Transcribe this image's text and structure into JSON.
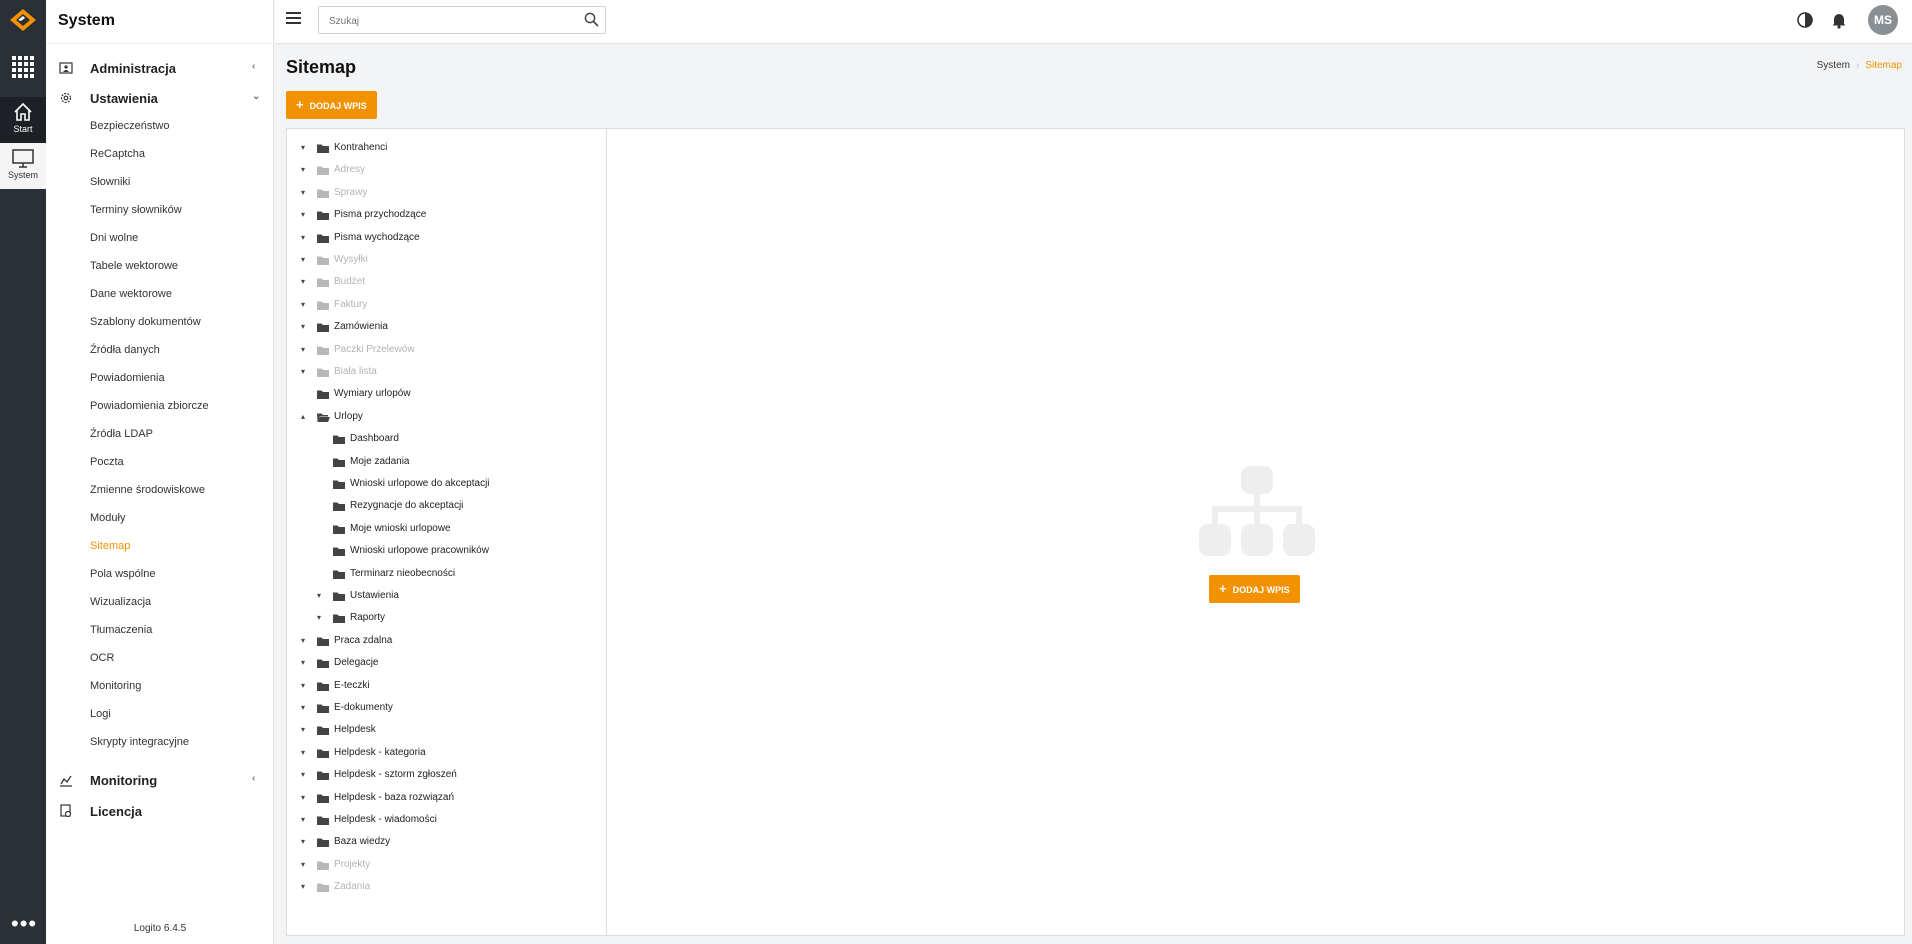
{
  "rail": {
    "items": [
      {
        "label": "Start"
      },
      {
        "label": "System"
      }
    ]
  },
  "sidebar": {
    "title": "System",
    "groups": [
      {
        "label": "Administracja",
        "expanded": false
      },
      {
        "label": "Ustawienia",
        "expanded": true
      },
      {
        "label": "Monitoring",
        "expanded": false
      },
      {
        "label": "Licencja"
      }
    ],
    "sub_items": [
      "Bezpieczeństwo",
      "ReCaptcha",
      "Słowniki",
      "Terminy słowników",
      "Dni wolne",
      "Tabele wektorowe",
      "Dane wektorowe",
      "Szablony dokumentów",
      "Źródła danych",
      "Powiadomienia",
      "Powiadomienia zbiorcze",
      "Źródła LDAP",
      "Poczta",
      "Zmienne środowiskowe",
      "Moduły",
      "Sitemap",
      "Pola wspólne",
      "Wizualizacja",
      "Tłumaczenia",
      "OCR",
      "Monitoring",
      "Logi",
      "Skrypty integracyjne"
    ],
    "active_sub": "Sitemap",
    "version": "Logito 6.4.5"
  },
  "topbar": {
    "search_placeholder": "Szukaj",
    "avatar_initials": "MS"
  },
  "page": {
    "title": "Sitemap",
    "breadcrumb": [
      "System",
      "Sitemap"
    ],
    "add_button": "DODAJ WPIS",
    "empty_add_button": "DODAJ WPIS"
  },
  "tree": [
    {
      "label": "Kontrahenci",
      "level": 0,
      "toggle": "collapsed",
      "muted": false
    },
    {
      "label": "Adresy",
      "level": 0,
      "toggle": "collapsed",
      "muted": true
    },
    {
      "label": "Sprawy",
      "level": 0,
      "toggle": "collapsed",
      "muted": true
    },
    {
      "label": "Pisma przychodzące",
      "level": 0,
      "toggle": "collapsed",
      "muted": false
    },
    {
      "label": "Pisma wychodzące",
      "level": 0,
      "toggle": "collapsed",
      "muted": false
    },
    {
      "label": "Wysyłki",
      "level": 0,
      "toggle": "collapsed",
      "muted": true
    },
    {
      "label": "Budżet",
      "level": 0,
      "toggle": "collapsed",
      "muted": true
    },
    {
      "label": "Faktury",
      "level": 0,
      "toggle": "collapsed",
      "muted": true
    },
    {
      "label": "Zamówienia",
      "level": 0,
      "toggle": "collapsed",
      "muted": false
    },
    {
      "label": "Paczki Przelewów",
      "level": 0,
      "toggle": "collapsed",
      "muted": true
    },
    {
      "label": "Biała lista",
      "level": 0,
      "toggle": "collapsed",
      "muted": true
    },
    {
      "label": "Wymiary urlopów",
      "level": 0,
      "toggle": "none",
      "muted": false
    },
    {
      "label": "Urlopy",
      "level": 0,
      "toggle": "expanded",
      "muted": false
    },
    {
      "label": "Dashboard",
      "level": 1,
      "toggle": "none",
      "muted": false
    },
    {
      "label": "Moje zadania",
      "level": 1,
      "toggle": "none",
      "muted": false
    },
    {
      "label": "Wnioski urlopowe do akceptacji",
      "level": 1,
      "toggle": "none",
      "muted": false
    },
    {
      "label": "Rezygnacje do akceptacji",
      "level": 1,
      "toggle": "none",
      "muted": false
    },
    {
      "label": "Moje wnioski urlopowe",
      "level": 1,
      "toggle": "none",
      "muted": false
    },
    {
      "label": "Wnioski urlopowe pracowników",
      "level": 1,
      "toggle": "none",
      "muted": false
    },
    {
      "label": "Terminarz nieobecności",
      "level": 1,
      "toggle": "none",
      "muted": false
    },
    {
      "label": "Ustawienia",
      "level": 1,
      "toggle": "collapsed",
      "muted": false
    },
    {
      "label": "Raporty",
      "level": 1,
      "toggle": "collapsed",
      "muted": false
    },
    {
      "label": "Praca zdalna",
      "level": 0,
      "toggle": "collapsed",
      "muted": false
    },
    {
      "label": "Delegacje",
      "level": 0,
      "toggle": "collapsed",
      "muted": false
    },
    {
      "label": "E-teczki",
      "level": 0,
      "toggle": "collapsed",
      "muted": false
    },
    {
      "label": "E-dokumenty",
      "level": 0,
      "toggle": "collapsed",
      "muted": false
    },
    {
      "label": "Helpdesk",
      "level": 0,
      "toggle": "collapsed",
      "muted": false
    },
    {
      "label": "Helpdesk - kategoria",
      "level": 0,
      "toggle": "collapsed",
      "muted": false
    },
    {
      "label": "Helpdesk - sztorm zgłoszeń",
      "level": 0,
      "toggle": "collapsed",
      "muted": false
    },
    {
      "label": "Helpdesk - baza rozwiązań",
      "level": 0,
      "toggle": "collapsed",
      "muted": false
    },
    {
      "label": "Helpdesk - wiadomości",
      "level": 0,
      "toggle": "collapsed",
      "muted": false
    },
    {
      "label": "Baza wiedzy",
      "level": 0,
      "toggle": "collapsed",
      "muted": false
    },
    {
      "label": "Projekty",
      "level": 0,
      "toggle": "collapsed",
      "muted": true
    },
    {
      "label": "Zadania",
      "level": 0,
      "toggle": "collapsed",
      "muted": true
    }
  ],
  "colors": {
    "accent": "#f39200",
    "rail": "#2b3036",
    "muted_text": "#b3b3b3"
  }
}
